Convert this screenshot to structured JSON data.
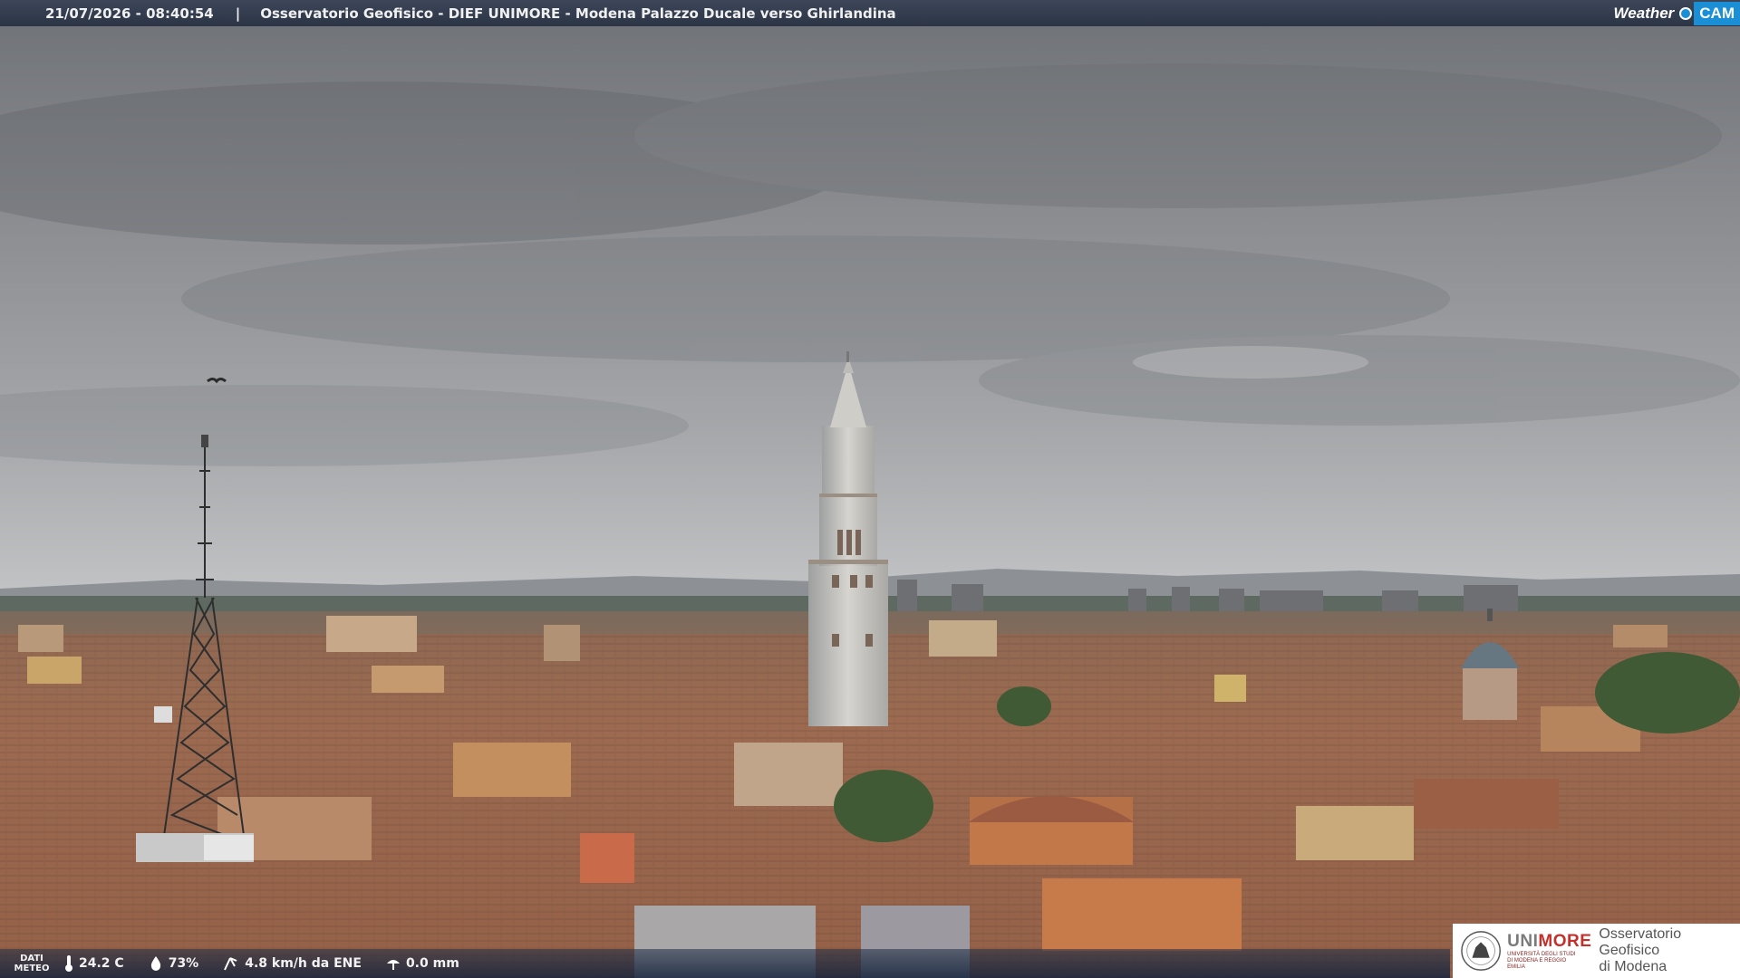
{
  "header": {
    "timestamp": "21/07/2026 - 08:40:54",
    "separator": "|",
    "title": "Osservatorio Geofisico - DIEF UNIMORE - Modena Palazzo Ducale verso Ghirlandina"
  },
  "brand": {
    "weather": "Weather",
    "cam": "CAM",
    "accent_color": "#1b8fd6"
  },
  "weather_data": {
    "label_line1": "DATI",
    "label_line2": "METEO",
    "temperature": "24.2 C",
    "humidity": "73%",
    "wind": "4.8 km/h da ENE",
    "rain": "0.0 mm",
    "icons": [
      "thermometer-icon",
      "humidity-drop-icon",
      "wind-icon",
      "rain-gauge-icon"
    ]
  },
  "logo": {
    "university": "UNIMORE",
    "university_accent": "MORE",
    "university_sub": "UNIVERSITÀ DEGLI STUDI DI MODENA E REGGIO EMILIA",
    "observatory_line1": "Osservatorio Geofisico",
    "observatory_line2": "di Modena"
  }
}
